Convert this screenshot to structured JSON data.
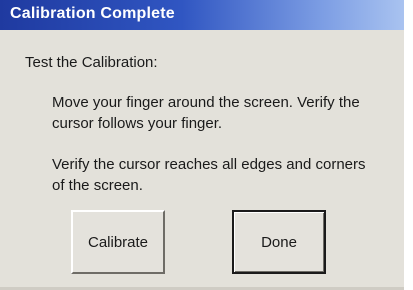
{
  "window": {
    "title": "Calibration Complete"
  },
  "content": {
    "heading": "Test the Calibration:",
    "paragraph1": "Move your finger around the screen. Verify the cursor follows your finger.",
    "paragraph2": "Verify the cursor reaches all edges and corners of the screen."
  },
  "buttons": {
    "calibrate_label": "Calibrate",
    "done_label": "Done"
  },
  "colors": {
    "titlebar_start": "#1f3aa0",
    "titlebar_end": "#a9c3f0",
    "dialog_background": "#e3e1da"
  }
}
